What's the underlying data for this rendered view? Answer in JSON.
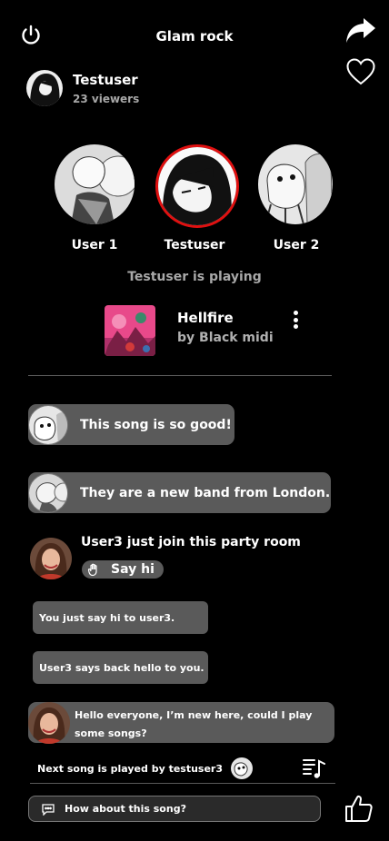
{
  "header": {
    "title": "Glam rock"
  },
  "host": {
    "name": "Testuser",
    "viewers": "23 viewers"
  },
  "participants": [
    {
      "label": "User 1",
      "selected": false
    },
    {
      "label": "Testuser",
      "selected": true
    },
    {
      "label": "User 2",
      "selected": false
    }
  ],
  "now_playing": {
    "status": "Testuser is playing",
    "title": "Hellfire",
    "artist": "by Black midi"
  },
  "chat": {
    "messages": [
      {
        "text": "This song is so good!"
      },
      {
        "text": "They are a new band from London."
      }
    ],
    "join_notice": "User3 just join this party room",
    "say_hi_label": "Say hi",
    "system_messages": [
      "You just say hi to user3.",
      "User3 says back hello to you."
    ],
    "newcomer_message": "Hello everyone, I’m new here, could I play some songs?"
  },
  "next_song": {
    "text": "Next song is played by testuser3"
  },
  "composer": {
    "placeholder": "How about this song?"
  },
  "colors": {
    "background": "#000000",
    "bubble": "#5a5a5a",
    "accent_selected": "#e01010"
  }
}
